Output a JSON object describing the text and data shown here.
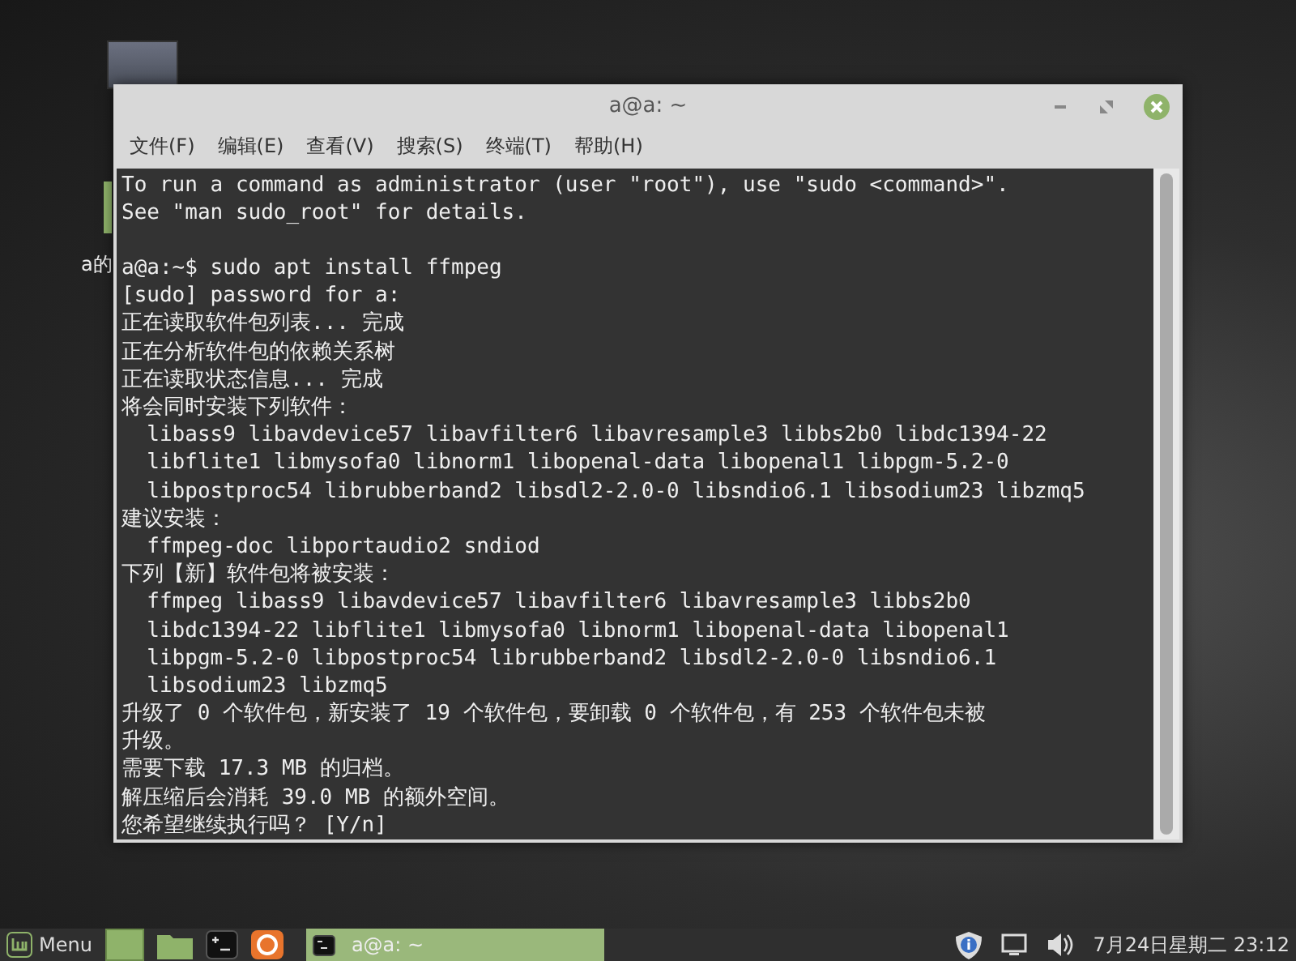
{
  "desktop": {
    "icons": [
      {
        "label": "a的"
      }
    ]
  },
  "window": {
    "title": "a@a: ~"
  },
  "menu": [
    {
      "label": "文件(F)"
    },
    {
      "label": "编辑(E)"
    },
    {
      "label": "查看(V)"
    },
    {
      "label": "搜索(S)"
    },
    {
      "label": "终端(T)"
    },
    {
      "label": "帮助(H)"
    }
  ],
  "terminal": {
    "notice": [
      "To run a command as administrator (user \"root\"), use \"sudo <command>\".",
      "See \"man sudo_root\" for details."
    ],
    "lines": [
      "a@a:~$ sudo apt install ffmpeg",
      "[sudo] password for a:",
      "正在读取软件包列表... 完成",
      "正在分析软件包的依赖关系树",
      "正在读取状态信息... 完成",
      "将会同时安装下列软件：",
      "  libass9 libavdevice57 libavfilter6 libavresample3 libbs2b0 libdc1394-22",
      "  libflite1 libmysofa0 libnorm1 libopenal-data libopenal1 libpgm-5.2-0",
      "  libpostproc54 librubberband2 libsdl2-2.0-0 libsndio6.1 libsodium23 libzmq5",
      "建议安装：",
      "  ffmpeg-doc libportaudio2 sndiod",
      "下列【新】软件包将被安装：",
      "  ffmpeg libass9 libavdevice57 libavfilter6 libavresample3 libbs2b0",
      "  libdc1394-22 libflite1 libmysofa0 libnorm1 libopenal-data libopenal1",
      "  libpgm-5.2-0 libpostproc54 librubberband2 libsdl2-2.0-0 libsndio6.1",
      "  libsodium23 libzmq5",
      "升级了 0 个软件包，新安装了 19 个软件包，要卸载 0 个软件包，有 253 个软件包未被",
      "升级。",
      "需要下载 17.3 MB 的归档。",
      "解压缩后会消耗 39.0 MB 的额外空间。",
      "您希望继续执行吗？ [Y/n]"
    ]
  },
  "taskbar": {
    "menu_label": "Menu",
    "launchers": [
      {
        "kind": "desktop"
      },
      {
        "kind": "files"
      },
      {
        "kind": "terminal"
      },
      {
        "kind": "browser"
      }
    ],
    "windows": [
      {
        "title": "a@a: ~",
        "selected": true
      }
    ],
    "clock": "7月24日星期二 23:12"
  }
}
